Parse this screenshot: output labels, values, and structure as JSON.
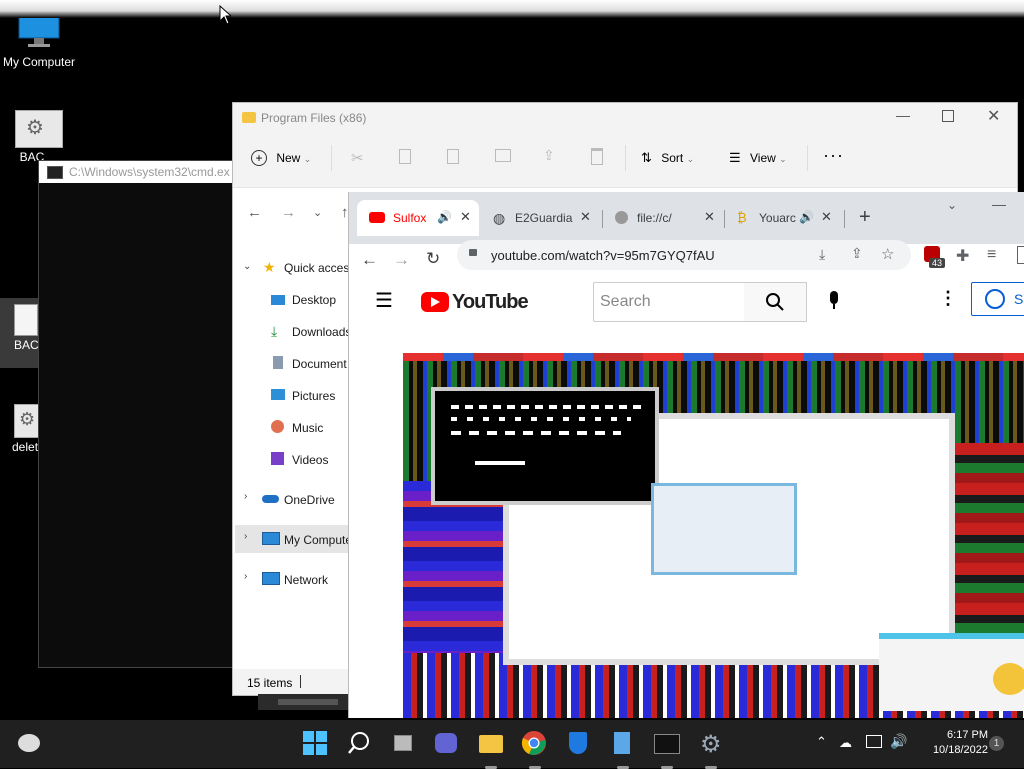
{
  "desktop": {
    "icons": [
      {
        "label": "My Computer"
      },
      {
        "label": "BAC"
      },
      {
        "label": "BAC"
      },
      {
        "label": "delet"
      }
    ]
  },
  "cmd": {
    "title": "C:\\Windows\\system32\\cmd.ex"
  },
  "explorer": {
    "title": "Program Files (x86)",
    "new_label": "New",
    "sort_label": "Sort",
    "view_label": "View",
    "nav": {
      "quick_access": "Quick access",
      "desktop": "Desktop",
      "downloads": "Downloads",
      "documents": "Document",
      "pictures": "Pictures",
      "music": "Music",
      "videos": "Videos",
      "onedrive": "OneDrive",
      "my_computer": "My Compute",
      "network": "Network"
    },
    "status": "15 items"
  },
  "chrome": {
    "tabs": [
      {
        "label": "Sulfox"
      },
      {
        "label": "E2Guardia"
      },
      {
        "label": "file://c/"
      },
      {
        "label": "Youarc"
      }
    ],
    "url": "youtube.com/watch?v=95m7GYQ7fAU",
    "ext_badge": "43"
  },
  "youtube": {
    "logo_text": "YouTube",
    "search_placeholder": "Search",
    "signin_label": "S"
  },
  "taskbar": {
    "time": "6:17 PM",
    "date": "10/18/2022",
    "notif_count": "1"
  },
  "colors": {
    "youtube_red": "#ff0000",
    "chrome_tabstrip": "#dee1e6",
    "taskbar": "#202020",
    "explorer_bg": "#f3f3f3",
    "link_blue": "#065fd4"
  }
}
